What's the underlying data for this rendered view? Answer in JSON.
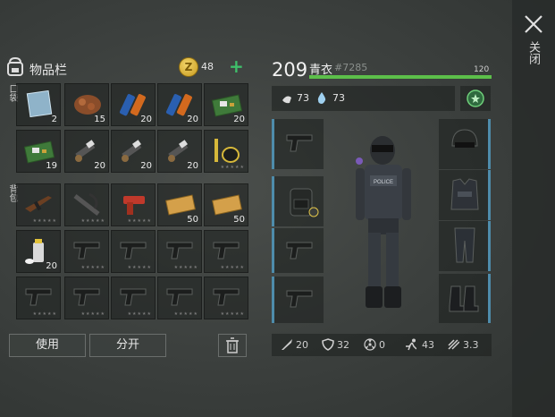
{
  "inventory": {
    "title": "物品栏",
    "coins": "48",
    "pocket_label": "口袋",
    "backpack_label": "背包",
    "pocket_slots": [
      {
        "icon": "glass-shard-icon",
        "count": "2"
      },
      {
        "icon": "copper-ore-icon",
        "count": "15"
      },
      {
        "icon": "battery-icon",
        "count": "20"
      },
      {
        "icon": "battery-icon",
        "count": "20"
      },
      {
        "icon": "circuit-board-icon",
        "count": "20"
      },
      {
        "icon": "circuit-board-icon",
        "count": "19"
      },
      {
        "icon": "spark-plug-icon",
        "count": "20"
      },
      {
        "icon": "spark-plug-icon",
        "count": "20"
      },
      {
        "icon": "spark-plug-icon",
        "count": "20"
      },
      {
        "icon": "snorkel-mask-icon",
        "count": ""
      }
    ],
    "backpack_slots": [
      {
        "icon": "assault-rifle-icon",
        "count": ""
      },
      {
        "icon": "crossbow-icon",
        "count": ""
      },
      {
        "icon": "flare-gun-icon",
        "count": ""
      },
      {
        "icon": "ticket-icon",
        "count": "50"
      },
      {
        "icon": "ticket-icon",
        "count": "50"
      },
      {
        "icon": "spray-can-icon",
        "count": "20"
      },
      {
        "icon": "pistol-icon",
        "count": ""
      },
      {
        "icon": "pistol-icon",
        "count": ""
      },
      {
        "icon": "pistol-icon",
        "count": ""
      },
      {
        "icon": "pistol-icon",
        "count": ""
      },
      {
        "icon": "pistol-icon",
        "count": ""
      },
      {
        "icon": "pistol-icon",
        "count": ""
      },
      {
        "icon": "pistol-icon",
        "count": ""
      },
      {
        "icon": "pistol-icon",
        "count": ""
      },
      {
        "icon": "pistol-icon",
        "count": ""
      }
    ],
    "use_label": "使用",
    "split_label": "分开"
  },
  "character": {
    "level": "209",
    "name": "青衣",
    "id": "#7285",
    "xp_max": "120",
    "xp_fraction": 1.0,
    "food": "73",
    "water": "73",
    "stats": {
      "attack": "20",
      "defense": "32",
      "radiation": "0",
      "speed": "43",
      "stealth": "3.3"
    }
  },
  "equipment": {
    "left": [
      "pistol-icon",
      "backpack-icon",
      "pistol-icon",
      "pistol-icon"
    ],
    "right": [
      "riot-helmet-icon",
      "police-vest-icon",
      "armored-pants-icon",
      "combat-boots-icon"
    ]
  },
  "close_label": "关闭",
  "colors": {
    "accent_green": "#5cbf4a",
    "slot_edge_blue": "#4e8cab",
    "coin_gold": "#e0b43a"
  }
}
